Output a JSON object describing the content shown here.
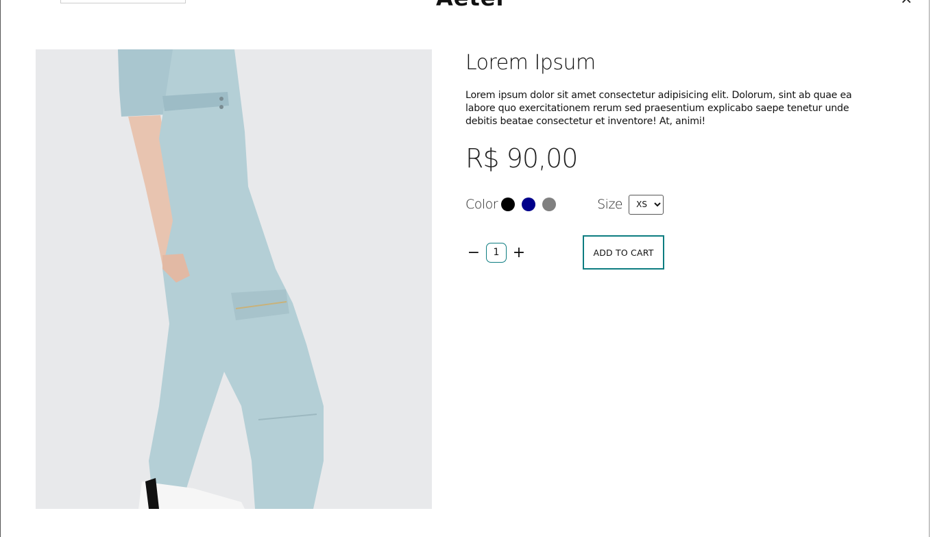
{
  "header": {
    "logo": "Aeter",
    "close_symbol": "×"
  },
  "product": {
    "title": "Lorem Ipsum",
    "description": "Lorem ipsum dolor sit amet consectetur adipisicing elit. Dolorum, sint ab quae ea labore quo exercitationem rerum sed praesentium explicabo saepe tenetur unde debitis beatae consectetur et inventore! At, animi!",
    "price": "R$ 90,00",
    "color_label": "Color",
    "colors": [
      "#000000",
      "#00008b",
      "#808080"
    ],
    "size_label": "Size",
    "size_selected": "XS",
    "quantity": "1",
    "minus_symbol": "−",
    "plus_symbol": "+",
    "add_to_cart_label": "ADD TO CART"
  }
}
